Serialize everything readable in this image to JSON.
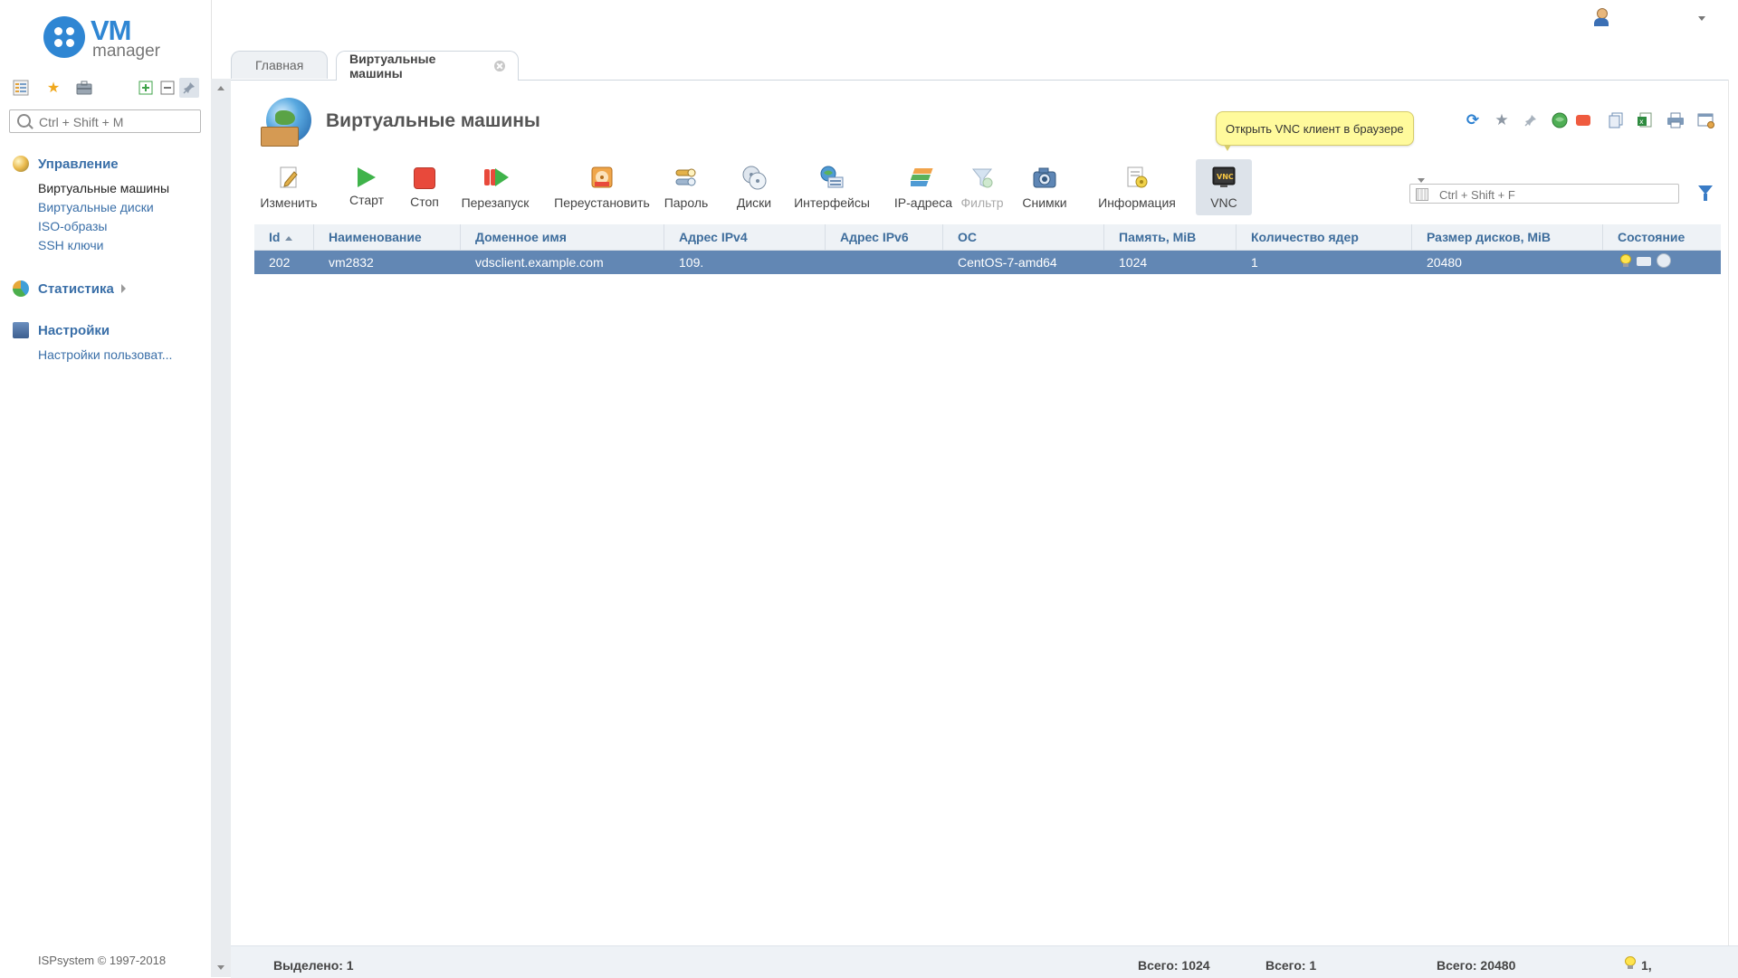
{
  "logo": {
    "vm": "VM",
    "manager": "manager"
  },
  "sidebar": {
    "search_placeholder": "Ctrl + Shift + M",
    "groups": [
      {
        "title": "Управление",
        "items": [
          "Виртуальные машины",
          "Виртуальные диски",
          "ISO-образы",
          "SSH ключи"
        ]
      },
      {
        "title": "Статистика",
        "items": []
      },
      {
        "title": "Настройки",
        "items": [
          "Настройки пользоват..."
        ]
      }
    ],
    "copyright": "ISPsystem © 1997-2018"
  },
  "tabs": [
    {
      "label": "Главная"
    },
    {
      "label": "Виртуальные машины"
    }
  ],
  "page": {
    "title": "Виртуальные машины"
  },
  "tooltip": "Открыть VNC клиент в браузере",
  "toolbar": {
    "buttons": {
      "edit": "Изменить",
      "start": "Старт",
      "stop": "Стоп",
      "restart": "Перезапуск",
      "reinstall": "Переустановить",
      "password": "Пароль",
      "disks": "Диски",
      "interfaces": "Интерфейсы",
      "ip": "IP-адреса",
      "filter": "Фильтр",
      "snapshots": "Снимки",
      "info": "Информация",
      "vnc": "VNC"
    },
    "search_placeholder": "Ctrl + Shift + F"
  },
  "table": {
    "columns": [
      "Id",
      "Наименование",
      "Доменное имя",
      "Адрес IPv4",
      "Адрес IPv6",
      "ОС",
      "Память, MiB",
      "Количество ядер",
      "Размер дисков, MiB",
      "Состояние"
    ],
    "rows": [
      {
        "id": "202",
        "name": "vm2832",
        "domain": "vdsclient.example.com",
        "ipv4": "109.",
        "ipv6": "",
        "os": "CentOS-7-amd64",
        "memory": "1024",
        "cores": "1",
        "disk": "20480"
      }
    ]
  },
  "footer": {
    "selected": "Выделено: 1",
    "total_memory": "Всего: 1024",
    "total_cores": "Всего: 1",
    "total_disk": "Всего: 20480",
    "state_count": "1,"
  },
  "colors": {
    "accent": "#2f86d3",
    "selected_row": "#6287b4",
    "link": "#3a6fa8"
  }
}
